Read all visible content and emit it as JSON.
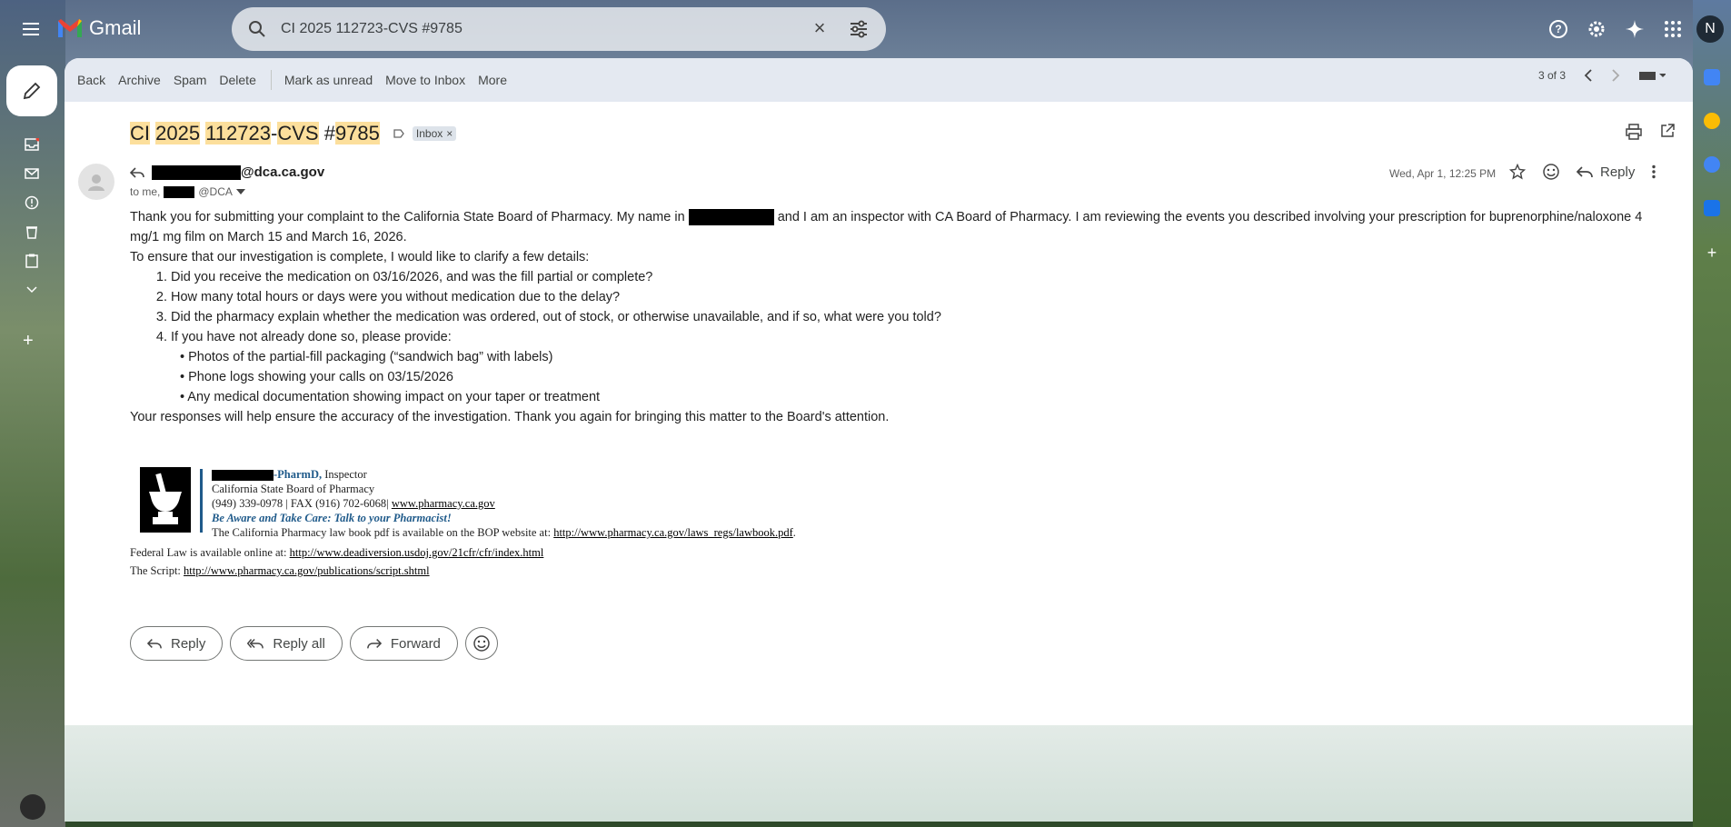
{
  "app": {
    "name": "Gmail",
    "avatar_letter": "N"
  },
  "search": {
    "query": "CI 2025 112723-CVS #9785"
  },
  "toolbar": {
    "back": "Back",
    "archive": "Archive",
    "spam": "Spam",
    "delete": "Delete",
    "mark_unread": "Mark as unread",
    "move_inbox": "Move to Inbox",
    "more": "More",
    "pager": "3 of 3"
  },
  "message": {
    "subject_parts": [
      "CI",
      "2025",
      "112723",
      "-",
      "CVS",
      "#",
      "9785"
    ],
    "label": "Inbox",
    "sender_domain": "@dca.ca.gov",
    "to_prefix": "to me,",
    "to_suffix": "@DCA",
    "date": "Wed, Apr 1, 12:25 PM",
    "reply_label": "Reply",
    "body": {
      "p1a": "Thank you for submitting your complaint to the California State Board of Pharmacy. My name in",
      "p1b": "and I am an inspector with CA Board of Pharmacy.  I am reviewing the events you described involving your prescription for buprenorphine/naloxone 4 mg/1 mg film on March 15 and March 16, 2026.",
      "p2": "To ensure that our investigation is complete, I would like to clarify a few details:",
      "q1": "Did you receive the medication on 03/16/2026, and was the fill partial or complete?",
      "q2": "How many total hours or days were you without medication due to the delay?",
      "q3": "Did the pharmacy explain whether the medication was ordered, out of stock, or otherwise unavailable, and if so, what were you told?",
      "q4": "If you have not already done so, please provide:",
      "b1": "• Photos of the partial-fill packaging (“sandwich bag” with labels)",
      "b2": "• Phone logs showing your calls on 03/15/2026",
      "b3": "• Any medical documentation showing impact on your taper or treatment",
      "p3": "Your responses will help ensure the accuracy of the investigation. Thank you again for bringing this matter to the Board's attention."
    },
    "signature": {
      "pharmd": "-PharmD,",
      "title": " Inspector",
      "org": "California State Board of Pharmacy",
      "phone": "(949) 339-0978 | FAX (916) 702-6068| ",
      "website": "www.pharmacy.ca.gov",
      "slogan": "Be Aware and Take Care: Talk to your Pharmacist!",
      "lawbook_text": "The California Pharmacy law book pdf is available on the BOP website at: ",
      "lawbook_link": "http://www.pharmacy.ca.gov/laws_regs/lawbook.pdf",
      "lawbook_end": ".",
      "federal_text": "Federal Law is available online at: ",
      "federal_link": "http://www.deadiversion.usdoj.gov/21cfr/cfr/index.html",
      "script_text": "The Script: ",
      "script_link": "http://www.pharmacy.ca.gov/publications/script.shtml"
    }
  },
  "actions": {
    "reply": "Reply",
    "reply_all": "Reply all",
    "forward": "Forward"
  },
  "colors": {
    "highlight": "#fcdf9c",
    "accent": "#1f5a8a",
    "gmail_red": "#ea4335"
  }
}
